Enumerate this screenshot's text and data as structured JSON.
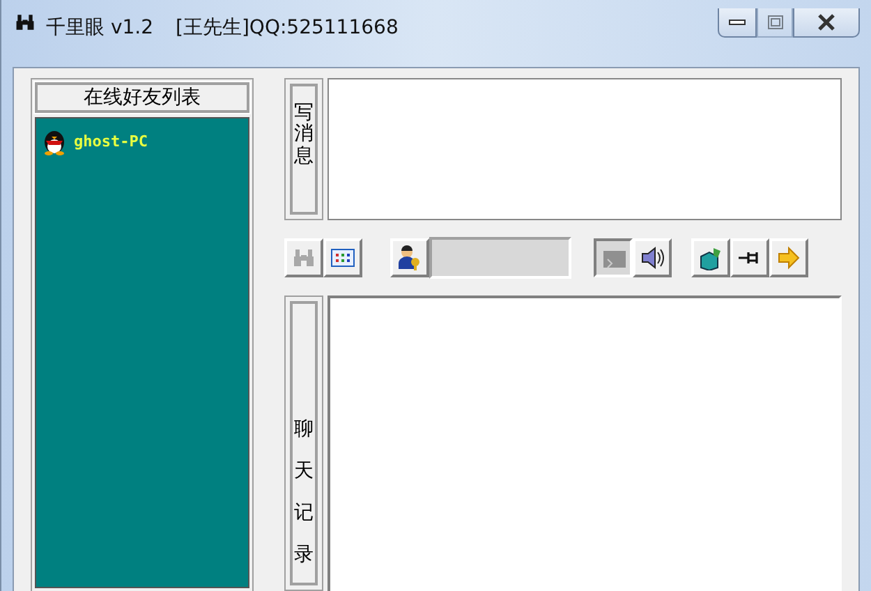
{
  "window": {
    "title": "千里眼 v1.2",
    "account": "[王先生]QQ:525111668",
    "controls": [
      {
        "kind": "minimize",
        "disabled": false
      },
      {
        "kind": "maximize",
        "disabled": true
      },
      {
        "kind": "close",
        "disabled": false
      }
    ]
  },
  "friends": {
    "header": "在线好友列表",
    "items": [
      {
        "name": "ghost-PC"
      }
    ]
  },
  "compose": {
    "label": "写消息"
  },
  "toolbar": [
    {
      "kind": "binoculars",
      "disabled": true,
      "pressed": false
    },
    {
      "kind": "grid",
      "disabled": false,
      "pressed": false
    },
    {
      "kind": "user-key",
      "disabled": false,
      "pressed": false
    },
    {
      "kind": "status",
      "disabled": false,
      "pressed": false
    },
    {
      "kind": "screen",
      "disabled": false,
      "pressed": true
    },
    {
      "kind": "speaker",
      "disabled": false,
      "pressed": false
    },
    {
      "kind": "cube",
      "disabled": false,
      "pressed": false
    },
    {
      "kind": "pin",
      "disabled": false,
      "pressed": false
    },
    {
      "kind": "arrow",
      "disabled": false,
      "pressed": false
    }
  ],
  "history": {
    "label": "聊天记录"
  }
}
